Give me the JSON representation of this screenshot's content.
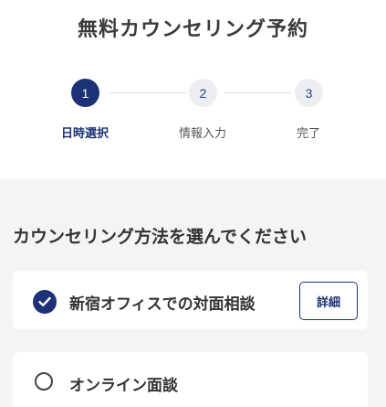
{
  "header": {
    "title": "無料カウンセリング予約"
  },
  "steps": [
    {
      "number": "1",
      "label": "日時選択",
      "state": "active"
    },
    {
      "number": "2",
      "label": "情報入力",
      "state": "inactive"
    },
    {
      "number": "3",
      "label": "完了",
      "state": "inactive"
    }
  ],
  "method": {
    "heading": "カウンセリング方法を選んでください",
    "options": [
      {
        "label": "新宿オフィスでの対面相談",
        "selected": true,
        "detail_label": "詳細"
      },
      {
        "label": "オンライン面談",
        "selected": false
      }
    ]
  },
  "colors": {
    "accent": "#1d3276",
    "background": "#f4f4f4"
  }
}
